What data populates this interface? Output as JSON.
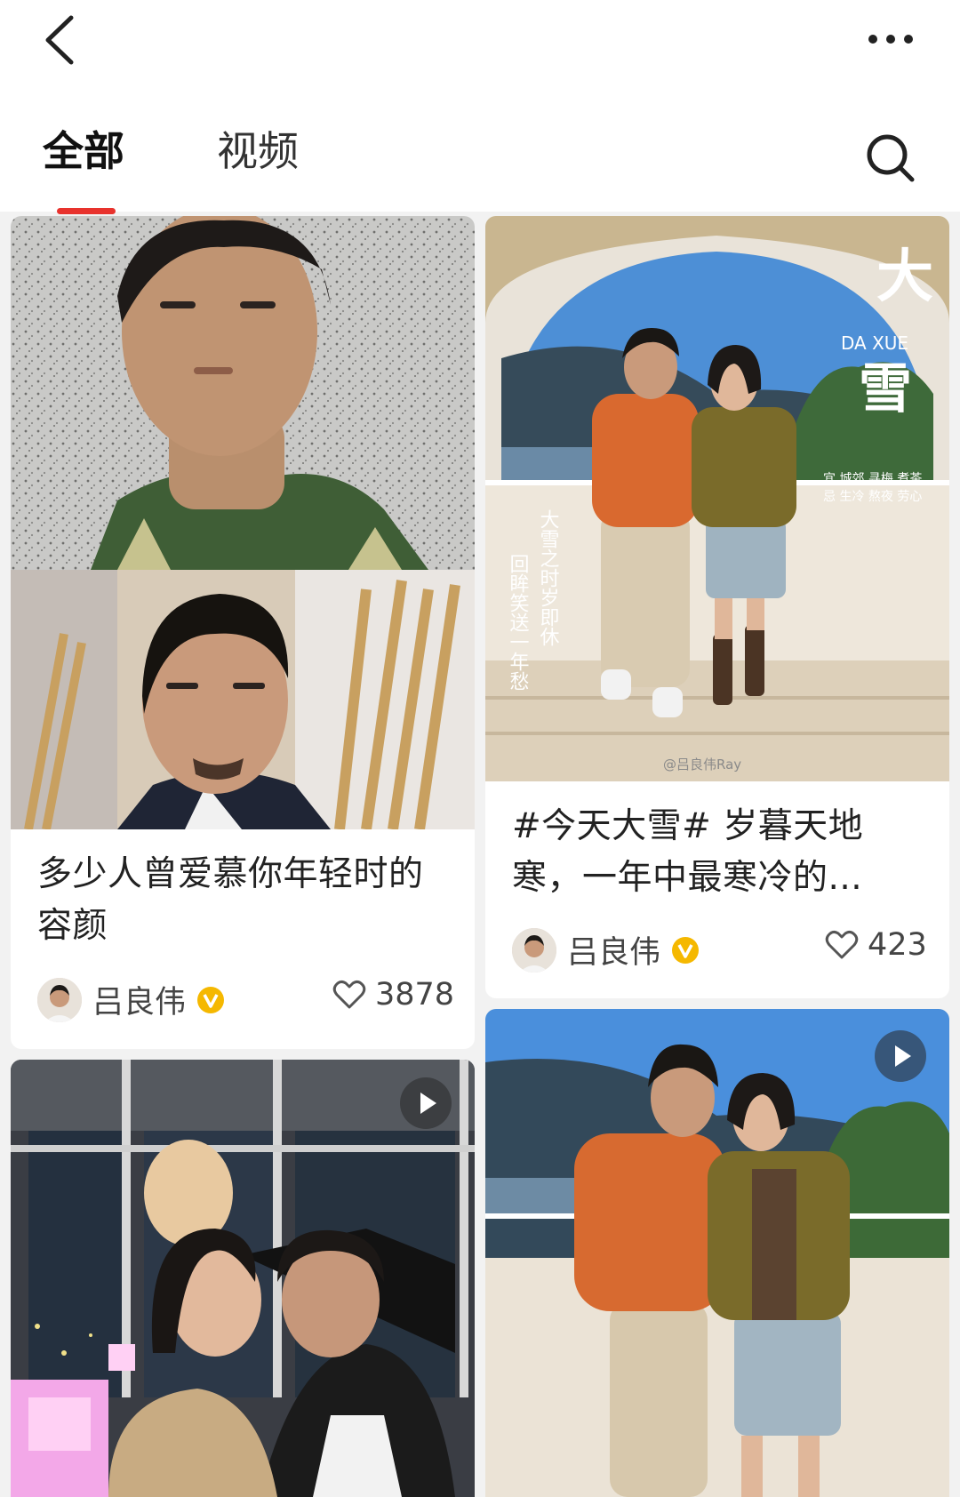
{
  "header": {
    "back_icon": "chevron-left-icon",
    "more_icon": "more-dots-icon",
    "search_icon": "search-icon"
  },
  "tabs": [
    {
      "label": "全部",
      "active": true
    },
    {
      "label": "视频",
      "active": false
    }
  ],
  "accent_color": "#e8322d",
  "feed": [
    {
      "title": "多少人曾爱慕你年轻时的容颜",
      "author": "吕良伟",
      "verified": true,
      "likes": "3878",
      "is_video": false
    },
    {
      "title": "#今天大雪# 岁暮天地寒，一年中最寒冷的...",
      "author": "吕良伟",
      "verified": true,
      "likes": "423",
      "is_video": false,
      "image_text": {
        "big_title": "大",
        "big_title_2": "雪",
        "pinyin": "DA XUE",
        "poem_line_1": "宜 城郊 寻梅 煮茶",
        "poem_line_2": "忌 生冷 熬夜 劳心",
        "vertical_line_1": "大雪之时岁即休",
        "vertical_line_2": "回眸笑送一年愁",
        "watermark": "@吕良伟Ray"
      }
    },
    {
      "is_video": true
    },
    {
      "is_video": true
    }
  ]
}
